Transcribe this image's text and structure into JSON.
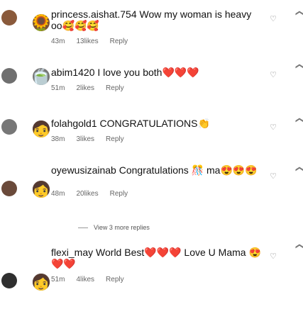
{
  "comments": [
    {
      "user": "princess.aishat.754",
      "text": "Wow my woman is heavy oo🥰🥰🥰",
      "time": "43m",
      "likes": "13likes",
      "reply": "Reply"
    },
    {
      "user": "abim1420",
      "text": "I love you both❤️❤️❤️",
      "time": "51m",
      "likes": "2likes",
      "reply": "Reply"
    },
    {
      "user": "folahgold1",
      "text": "CONGRATULATIONS👏",
      "time": "38m",
      "likes": "3likes",
      "reply": "Reply"
    },
    {
      "user": "oyewusizainab",
      "text": "Congratulations 🎊 ma😍😍😍",
      "time": "48m",
      "likes": "20likes",
      "reply": "Reply"
    },
    {
      "user": "flexi_may",
      "text": "World Best❤️❤️❤️ Love U Mama 😍❤️❤️",
      "time": "51m",
      "likes": "4likes",
      "reply": "Reply"
    }
  ],
  "view_more_replies": "View 3 more replies",
  "icons": {
    "like": "heart-outline-icon"
  }
}
